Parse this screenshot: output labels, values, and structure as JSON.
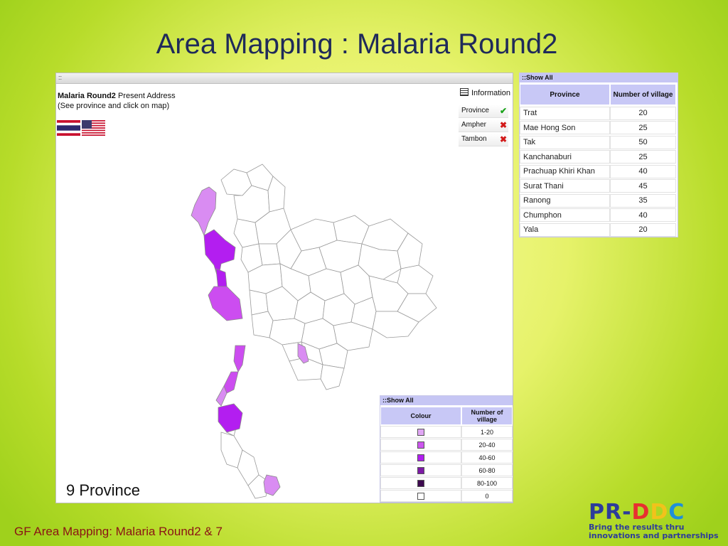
{
  "slide": {
    "title": "Area Mapping : Malaria Round2",
    "footer": "GF Area Mapping: Malaria Round2 & 7"
  },
  "logo": {
    "letters": [
      "PR",
      "-",
      "D",
      "D",
      "C"
    ],
    "tagline_1": "Bring the results thru",
    "tagline_2": "innovations and partnerships"
  },
  "map_panel": {
    "bar_text": "::",
    "title_bold": "Malaria Round2",
    "title_rest": " Present Address",
    "hint": "(See province and click on map)",
    "info_label": "Information",
    "levels": [
      {
        "label": "Province",
        "enabled": true,
        "mark": "✔"
      },
      {
        "label": "Ampher",
        "enabled": false,
        "mark": "✖"
      },
      {
        "label": "Tambon",
        "enabled": false,
        "mark": "✖"
      }
    ],
    "province_count": "9 Province",
    "colors": {
      "light": "#d98cf2",
      "medium": "#cc4df0",
      "dark": "#b31ef0",
      "outline": "#9a9a9a"
    }
  },
  "legend": {
    "bar_text": "::Show All",
    "header_colour": "Colour",
    "header_count": "Number of village",
    "rows": [
      {
        "swatch": "#e0a6f4",
        "range": "1-20"
      },
      {
        "swatch": "#cc55ee",
        "range": "20-40"
      },
      {
        "swatch": "#b01ef0",
        "range": "40-60"
      },
      {
        "swatch": "#7d1aa6",
        "range": "60-80"
      },
      {
        "swatch": "#3d0a4f",
        "range": "80-100"
      },
      {
        "swatch": "#ffffff",
        "range": "0"
      }
    ]
  },
  "province_table": {
    "bar_text": "::Show All",
    "header_province": "Province",
    "header_count": "Number of village",
    "rows": [
      {
        "province": "Trat",
        "villages": "20"
      },
      {
        "province": "Mae Hong Son",
        "villages": "25"
      },
      {
        "province": "Tak",
        "villages": "50"
      },
      {
        "province": "Kanchanaburi",
        "villages": "25"
      },
      {
        "province": "Prachuap Khiri Khan",
        "villages": "40"
      },
      {
        "province": "Surat Thani",
        "villages": "45"
      },
      {
        "province": "Ranong",
        "villages": "35"
      },
      {
        "province": "Chumphon",
        "villages": "40"
      },
      {
        "province": "Yala",
        "villages": "20"
      }
    ]
  }
}
